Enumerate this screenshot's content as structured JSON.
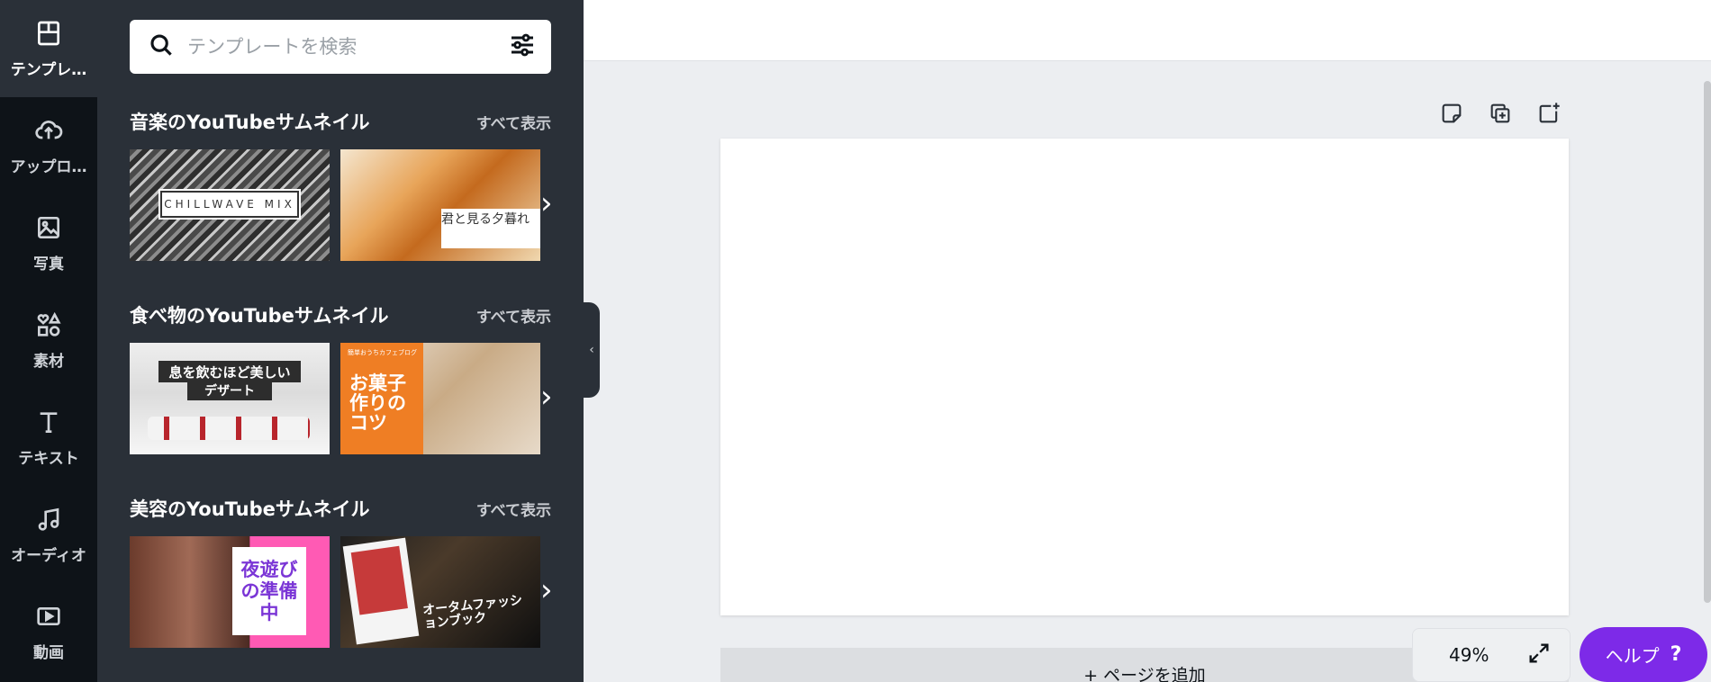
{
  "rail": {
    "items": [
      {
        "label": "テンプレ…",
        "icon": "template-icon",
        "active": true
      },
      {
        "label": "アップロ…",
        "icon": "upload-icon"
      },
      {
        "label": "写真",
        "icon": "photo-icon"
      },
      {
        "label": "素材",
        "icon": "elements-icon"
      },
      {
        "label": "テキスト",
        "icon": "text-icon"
      },
      {
        "label": "オーディオ",
        "icon": "audio-icon"
      },
      {
        "label": "動画",
        "icon": "video-icon"
      }
    ]
  },
  "search": {
    "placeholder": "テンプレートを検索",
    "value": ""
  },
  "sections": [
    {
      "title": "音楽のYouTubeサムネイル",
      "see_all": "すべて表示",
      "thumbs": [
        {
          "text": "CHILLWAVE MIX"
        },
        {
          "text": "君と見る夕暮れ"
        }
      ]
    },
    {
      "title": "食べ物のYouTubeサムネイル",
      "see_all": "すべて表示",
      "thumbs": [
        {
          "line1": "息を飲むほど美しい",
          "line2": "デザート"
        },
        {
          "small": "簡単おうちカフェブログ",
          "big": "お菓子作りのコツ"
        }
      ]
    },
    {
      "title": "美容のYouTubeサムネイル",
      "see_all": "すべて表示",
      "thumbs": [
        {
          "text": "夜遊びの準備中"
        },
        {
          "text": "オータムファッションブック"
        }
      ]
    }
  ],
  "workspace": {
    "add_page": "+ ページを追加",
    "zoom": "49%",
    "help": {
      "label": "ヘルプ",
      "mark": "?"
    }
  },
  "colors": {
    "rail": "#0e1318",
    "panel": "#2a3038",
    "help": "#7d2ae8",
    "background": "#eceef1"
  }
}
